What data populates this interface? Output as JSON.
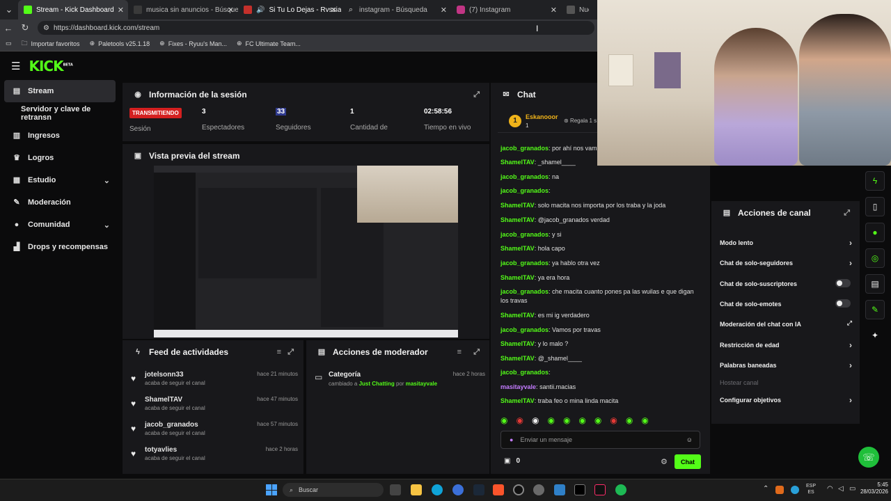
{
  "browser": {
    "tabs": [
      {
        "title": "Stream - Kick Dashboard",
        "active": true
      },
      {
        "title": "musica sin anuncios - Búsqueda"
      },
      {
        "title": "Si Tu Lo Dejas - Rvssian - Esc"
      },
      {
        "title": "instagram - Búsqueda"
      },
      {
        "title": "(7) Instagram"
      },
      {
        "title": "Nue"
      }
    ],
    "url": "https://dashboard.kick.com/stream",
    "bookmarks": [
      "Importar favoritos",
      "Paletools v25.1.18",
      "Fixes - Ryuu's Man...",
      "FC Ultimate Team..."
    ]
  },
  "brand": {
    "logo": "KICK",
    "badge": "BETA",
    "accent": "#53fc18"
  },
  "sidebar": {
    "items": [
      {
        "label": "Stream",
        "icon": "stream-icon"
      },
      {
        "label": "Servidor y clave de retransn",
        "icon": ""
      },
      {
        "label": "Ingresos",
        "icon": "revenue-icon"
      },
      {
        "label": "Logros",
        "icon": "trophy-icon"
      },
      {
        "label": "Estudio",
        "icon": "studio-icon"
      },
      {
        "label": "Moderación",
        "icon": "wrench-icon"
      },
      {
        "label": "Comunidad",
        "icon": "community-icon"
      },
      {
        "label": "Drops y recompensas",
        "icon": "drops-icon"
      }
    ]
  },
  "session": {
    "title": "Información de la sesión",
    "status": "TRANSMITIENDO",
    "status_label": "Sesión",
    "viewers": "3",
    "viewers_label": "Espectadores",
    "followers": "33",
    "followers_label": "Seguidores",
    "count": "1",
    "count_label": "Cantidad de",
    "uptime": "02:58:56",
    "uptime_label": "Tiempo en vivo"
  },
  "preview": {
    "title": "Vista previa del stream"
  },
  "feed": {
    "title": "Feed de actividades",
    "items": [
      {
        "name": "jotelsonn33",
        "action": "acaba de seguir el canal",
        "time": "hace 21 minutos"
      },
      {
        "name": "ShamelTAV",
        "action": "acaba de seguir el canal",
        "time": "hace 47 minutos"
      },
      {
        "name": "jacob_granados",
        "action": "acaba de seguir el canal",
        "time": "hace 57 minutos"
      },
      {
        "name": "totyavlies",
        "action": "acaba de seguir el canal",
        "time": "hace 2 horas"
      }
    ]
  },
  "moderator": {
    "title": "Acciones de moderador",
    "item_title": "Categoría",
    "item_prefix": "cambiado a",
    "item_value": "Just Chatting",
    "item_by": "por",
    "item_user": "masitayvale",
    "item_time": "hace 2 horas"
  },
  "chat": {
    "title": "Chat",
    "pinned_user": "Eskanooor",
    "pinned_count": "1",
    "gift": "Regala 1 s",
    "messages": [
      {
        "user": "jacob_granados",
        "text": "por ahí nos vamo"
      },
      {
        "user": "ShamelTAV",
        "text": "_shamel____"
      },
      {
        "user": "jacob_granados",
        "text": "na"
      },
      {
        "user": "jacob_granados",
        "text": ""
      },
      {
        "user": "ShamelTAV",
        "text": "solo macita nos importa por los traba y la joda"
      },
      {
        "user": "ShamelTAV",
        "text": "@jacob_granados verdad"
      },
      {
        "user": "jacob_granados",
        "text": "y si"
      },
      {
        "user": "ShamelTAV",
        "text": "hola capo"
      },
      {
        "user": "jacob_granados",
        "text": "ya hablo otra vez"
      },
      {
        "user": "ShamelTAV",
        "text": "ya era hora"
      },
      {
        "user": "jacob_granados",
        "text": "che macita cuanto pones pa las wuilas e que digan los travas"
      },
      {
        "user": "ShamelTAV",
        "text": "es mi ig verdadero"
      },
      {
        "user": "jacob_granados",
        "text": "Vamos por travas"
      },
      {
        "user": "ShamelTAV",
        "text": "y lo malo ?"
      },
      {
        "user": "ShamelTAV",
        "text": "@_shamel____"
      },
      {
        "user": "jacob_granados",
        "text": ""
      },
      {
        "user": "masitayvale",
        "text": "santii.macias"
      },
      {
        "user": "ShamelTAV",
        "text": "traba feo o mina linda macita"
      }
    ],
    "input_placeholder": "Enviar un mensaje",
    "points": "0",
    "send_label": "Chat"
  },
  "channel_actions": {
    "title": "Acciones de canal",
    "items": [
      {
        "label": "Modo lento",
        "control": "arrow"
      },
      {
        "label": "Chat de solo-seguidores",
        "control": "arrow"
      },
      {
        "label": "Chat de solo-suscriptores",
        "control": "toggle"
      },
      {
        "label": "Chat de solo-emotes",
        "control": "toggle"
      },
      {
        "label": "Moderación del chat con IA",
        "control": "external"
      },
      {
        "label": "Restricción de edad",
        "control": "arrow"
      },
      {
        "label": "Palabras baneadas",
        "control": "arrow"
      },
      {
        "label": "Hostear canal",
        "control": "none",
        "disabled": true
      },
      {
        "label": "Configurar objetivos",
        "control": "arrow"
      }
    ]
  },
  "taskbar": {
    "search_placeholder": "Buscar",
    "lang_top": "ESP",
    "lang_bottom": "ES",
    "time": "5:45",
    "date": "28/03/2026"
  }
}
